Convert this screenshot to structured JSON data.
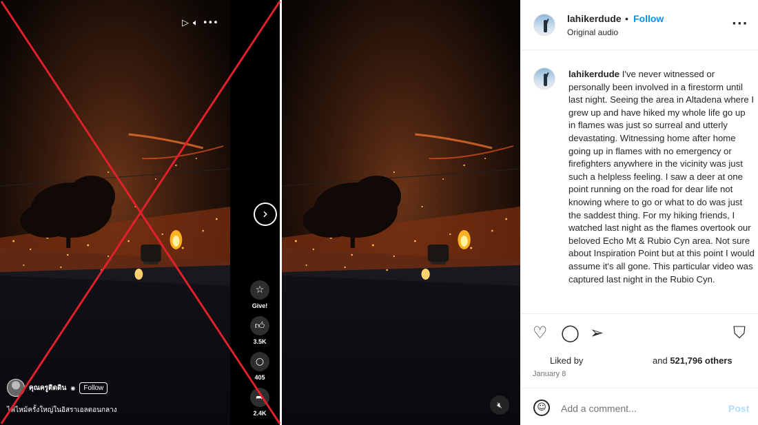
{
  "reel": {
    "top_icons": [
      "play-icon",
      "mute-icon",
      "more-icon"
    ],
    "next_icon": "chevron-right-icon",
    "give_label": "Give!",
    "likes": "3.5K",
    "comments": "405",
    "shares": "2.4K",
    "author": "คุณครูติดดิน",
    "follow_label": "Follow",
    "caption": "ไฟไหม้ครั้งใหญ่ในอิสราเอลตอนกลาง"
  },
  "fake_marker": {
    "type": "red-x",
    "color": "#e0202a"
  },
  "video": {
    "mute_icon": "speaker-muted-icon"
  },
  "post": {
    "username": "lahikerdude",
    "separator": "•",
    "follow_label": "Follow",
    "audio": "Original audio",
    "caption_user": "lahikerdude",
    "caption_text": " I've never witnessed or personally been involved in a firestorm until last night. Seeing the area in Altadena where I grew up and have hiked my whole life go up in flames was just so surreal and utterly devastating. Witnessing home after home going up in flames with no emergency or firefighters anywhere in the vicinity was just such a helpless feeling. I saw a deer at one point running on the road for dear life not knowing where to go or what to do was just the saddest thing. For my hiking friends, I watched last night as the flames overtook our beloved Echo Mt & Rubio Cyn area. Not sure about Inspiration Point but at this point I would assume it's all gone. This particular video was captured last night in the Rubio Cyn.",
    "liked_by_label": "Liked by",
    "liked_others_prefix": "and ",
    "liked_others_count": "521,796 others",
    "date": "January 8",
    "comment_placeholder": "Add a comment...",
    "post_button": "Post",
    "colors": {
      "follow": "#0095f6",
      "post_disabled": "#b3dbff"
    }
  }
}
